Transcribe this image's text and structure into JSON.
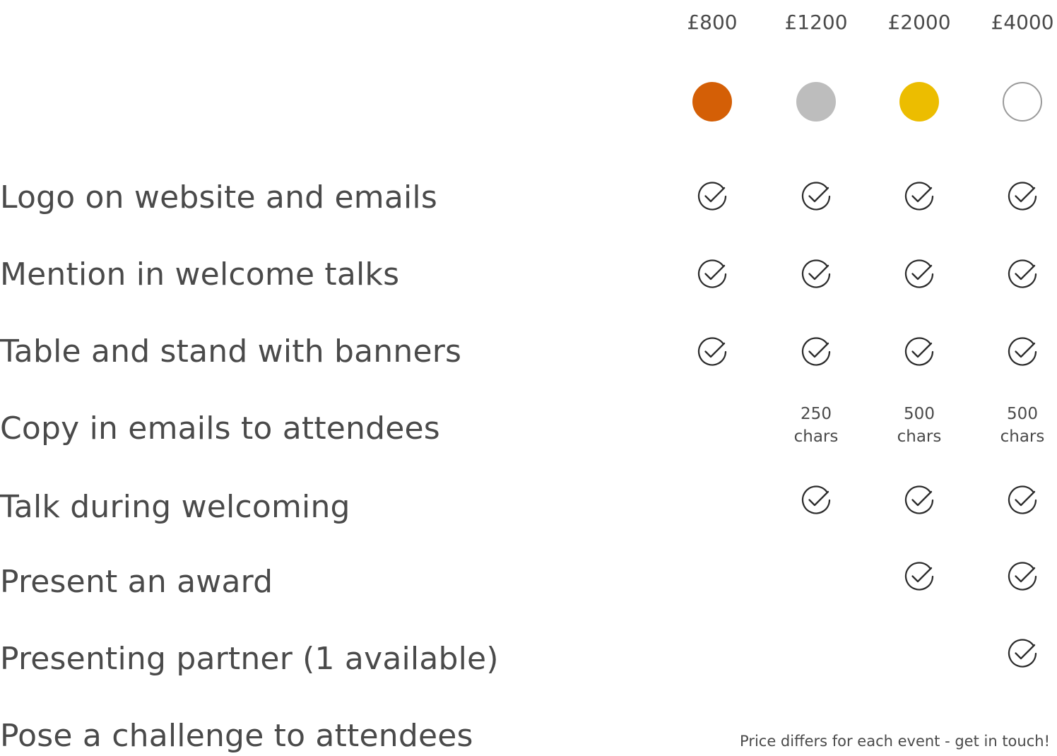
{
  "tiers": [
    {
      "price": "£800",
      "color": "#d45f06",
      "outline": false
    },
    {
      "price": "£1200",
      "color": "#bdbdbd",
      "outline": false
    },
    {
      "price": "£2000",
      "color": "#ecbd00",
      "outline": false
    },
    {
      "price": "£4000",
      "color": "#ffffff",
      "outline": true
    }
  ],
  "features": [
    {
      "label": "Logo on website and emails",
      "cells": [
        "check-icon",
        "check-icon",
        "check-icon",
        "check-icon"
      ]
    },
    {
      "label": "Mention in welcome talks",
      "cells": [
        "check-icon",
        "check-icon",
        "check-icon",
        "check-icon"
      ]
    },
    {
      "label": "Table and stand with banners",
      "cells": [
        "check-icon",
        "check-icon",
        "check-icon",
        "check-icon"
      ]
    },
    {
      "label": "Copy in emails to attendees",
      "cells": [
        "",
        [
          "250",
          "chars"
        ],
        [
          "500",
          "chars"
        ],
        [
          "500",
          "chars"
        ]
      ]
    },
    {
      "label": "Talk during welcoming",
      "cells": [
        "",
        "check-icon",
        "check-icon",
        "check-icon"
      ]
    },
    {
      "label": "Present an award",
      "cells": [
        "",
        "",
        "check-icon",
        "check-icon"
      ]
    },
    {
      "label": "Presenting partner (1 available)",
      "cells": [
        "",
        "",
        "",
        "check-icon"
      ]
    },
    {
      "label": "Pose a challenge to attendees",
      "cells": [
        "",
        "",
        "",
        ""
      ]
    }
  ],
  "challenge_note": "Price differs for each event - get in touch!"
}
